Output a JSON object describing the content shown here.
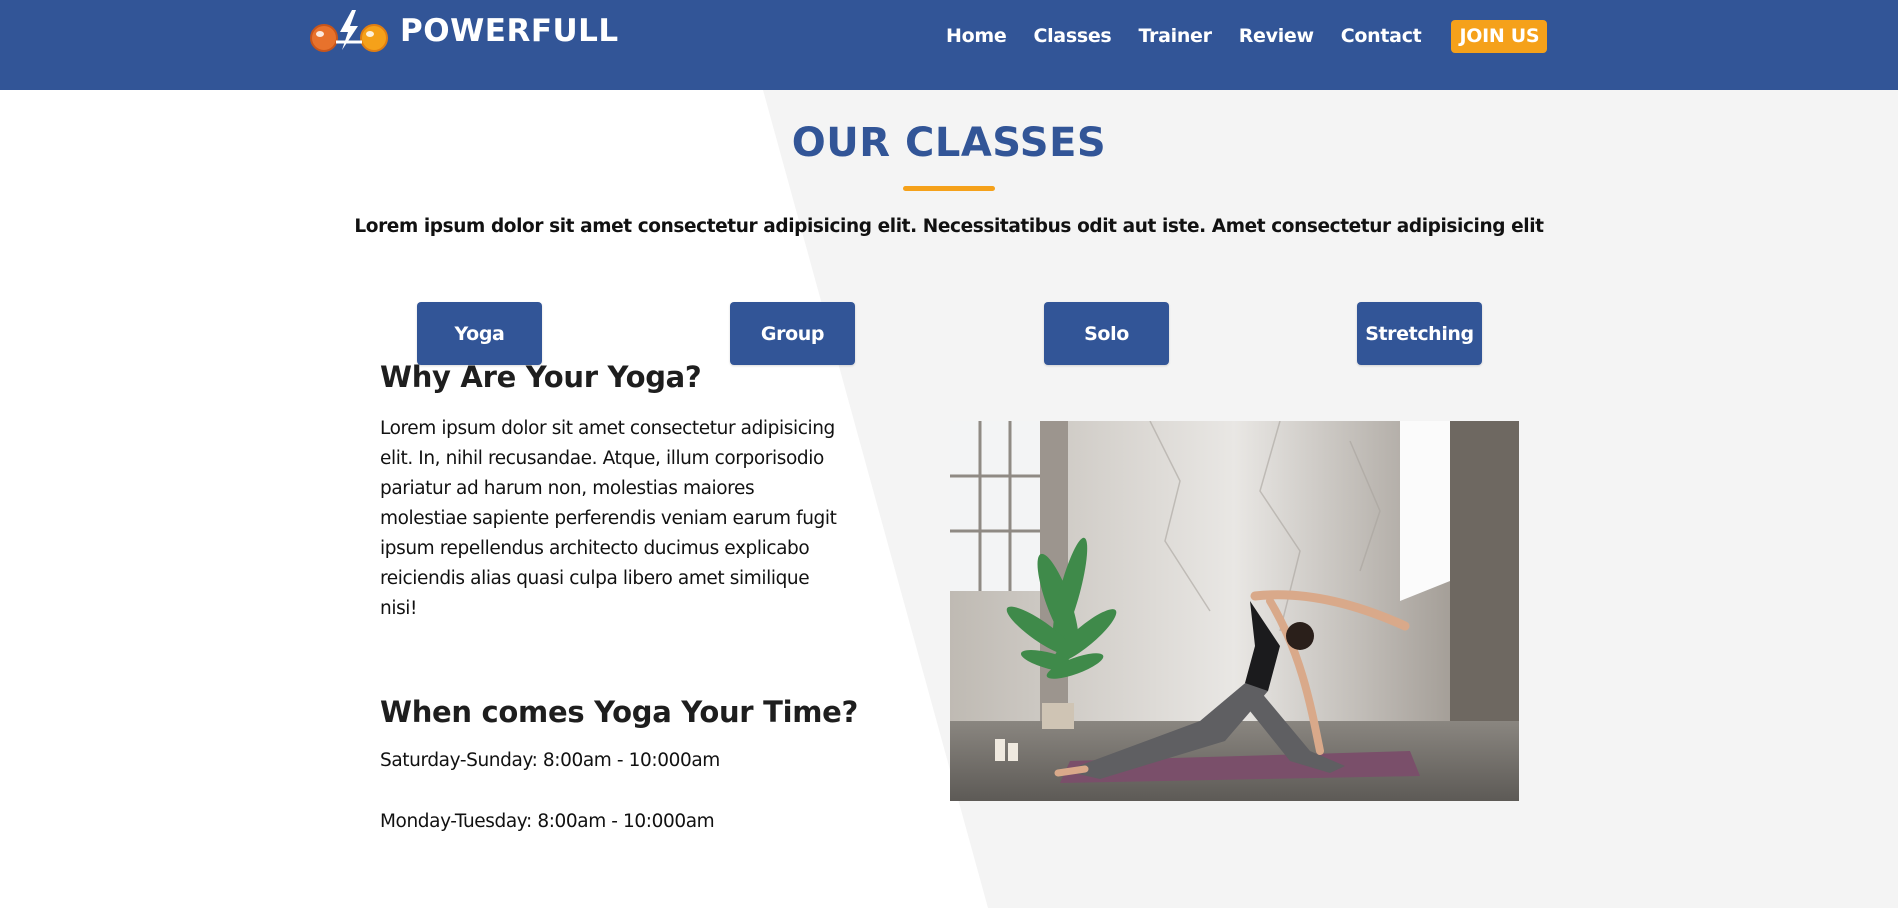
{
  "brand": {
    "name": "POWERFULL",
    "logo_icon": "dumbbell-bolt-logo",
    "colors": {
      "primary": "#325597",
      "accent": "#f5a11a"
    }
  },
  "nav": {
    "items": [
      {
        "label": "Home"
      },
      {
        "label": "Classes"
      },
      {
        "label": "Trainer"
      },
      {
        "label": "Review"
      },
      {
        "label": "Contact"
      }
    ],
    "join_label": "JOIN US"
  },
  "classes": {
    "title": "OUR CLASSES",
    "intro": "Lorem ipsum dolor sit amet consectetur adipisicing elit. Necessitatibus odit aut iste. Amet consectetur adipisicing elit",
    "buttons": [
      {
        "label": "Yoga"
      },
      {
        "label": "Group"
      },
      {
        "label": "Solo"
      },
      {
        "label": "Stretching"
      }
    ]
  },
  "yoga": {
    "why_heading": "Why Are Your Yoga?",
    "why_text": "Lorem ipsum dolor sit amet consectetur adipisicing elit. In, nihil recusandae. Atque, illum corporisodio pariatur ad harum non, molestias maiores molestiae sapiente perferendis veniam earum fugit ipsum repellendus architecto ducimus explicabo reiciendis alias quasi culpa libero amet similique nisi!",
    "when_heading": "When comes Yoga Your Time?",
    "schedule": [
      "Saturday-Sunday: 8:00am - 10:000am",
      "Monday-Tuesday: 8:00am - 10:000am"
    ],
    "image_icon": "yoga-woman-photo"
  }
}
